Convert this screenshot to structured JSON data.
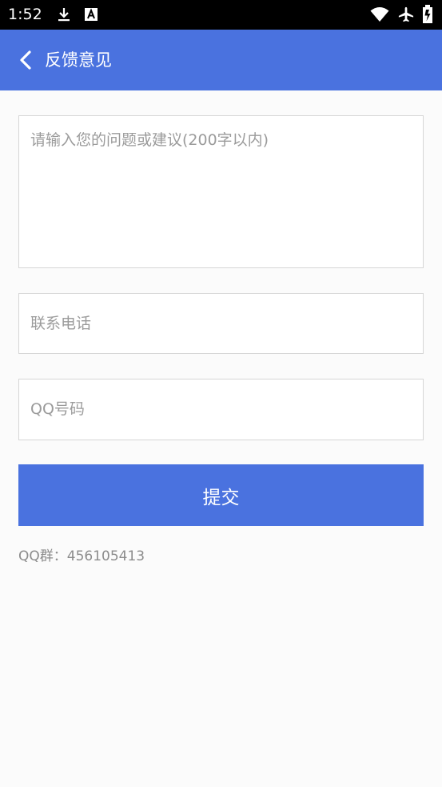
{
  "status_bar": {
    "time": "1:52",
    "left_icons": [
      "download-icon",
      "a-notification-icon"
    ],
    "right_icons": [
      "wifi-icon",
      "airplane-icon",
      "battery-icon"
    ]
  },
  "app_bar": {
    "back_icon": "chevron-left-icon",
    "title": "反馈意见",
    "background": "#4a72df"
  },
  "form": {
    "feedback_placeholder": "请输入您的问题或建议(200字以内)",
    "phone_placeholder": "联系电话",
    "qq_placeholder": "QQ号码",
    "submit_label": "提交"
  },
  "footer": {
    "qq_group": "QQ群：456105413"
  }
}
